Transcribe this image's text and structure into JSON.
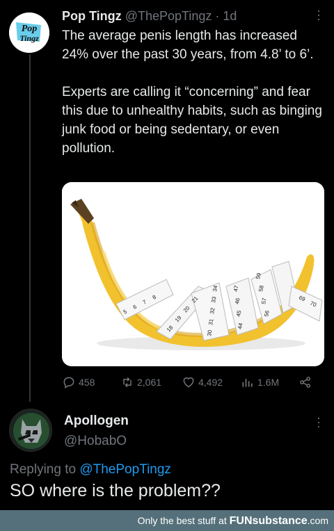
{
  "tweet": {
    "author_name": "Pop Tingz",
    "handle": "@ThePopTingz",
    "separator": "·",
    "time": "1d",
    "avatar_text_top": "Pop",
    "avatar_text_bottom": "Tingz",
    "paragraphs": [
      "The average penis length has increased 24% over the past 30 years, from 4.8’ to 6’.",
      "Experts are calling it “concerning” and fear this due to unhealthy habits, such as binging junk food or being sedentary, or even pollution."
    ],
    "tape_numbers": [
      "5",
      "6",
      "7",
      "8",
      "18",
      "19",
      "20",
      "21",
      "30",
      "31",
      "32",
      "33",
      "34",
      "44",
      "45",
      "46",
      "47",
      "56",
      "57",
      "58",
      "59",
      "69",
      "70"
    ],
    "actions": {
      "replies": "458",
      "retweets": "2,061",
      "likes": "4,492",
      "views": "1.6M"
    }
  },
  "reply": {
    "author_name": "Apollogen",
    "handle": "@HobabO",
    "replying_prefix": "Replying to",
    "replying_to": "@ThePopTingz",
    "text": "SO where is the problem??"
  },
  "footer": {
    "tagline": "Only the best stuff at",
    "brand": "FUNsubstance",
    "domain": ".com"
  },
  "colors": {
    "background": "#000000",
    "text": "#e7e9ea",
    "muted": "#71767b",
    "link": "#1d9bf0",
    "footer_bg": "#55707a",
    "banana": "#f2c12e"
  }
}
